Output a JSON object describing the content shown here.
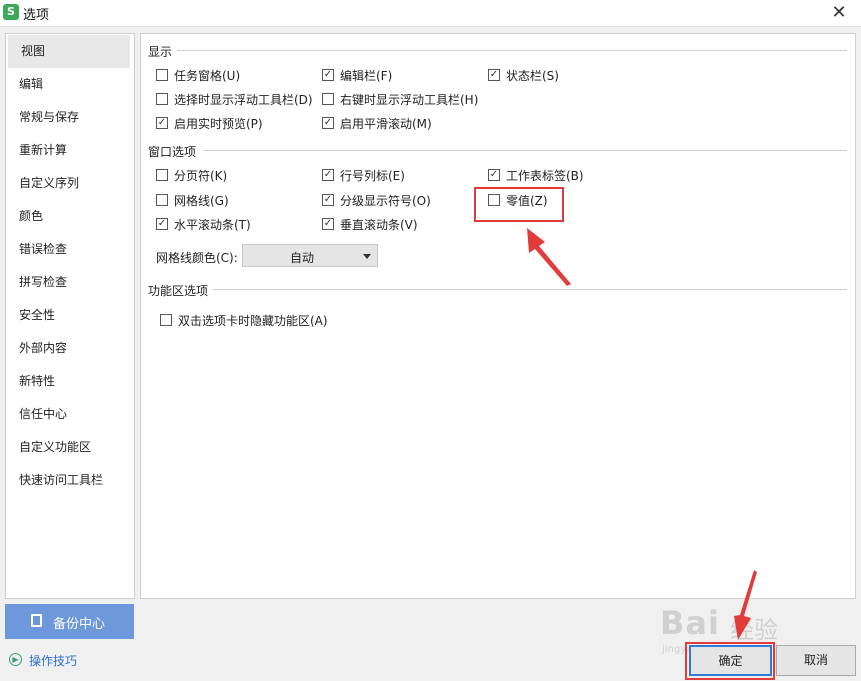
{
  "window": {
    "title": "选项",
    "app_icon_letter": "S",
    "close_symbol": "✕"
  },
  "sidebar": {
    "items": [
      {
        "label": "视图",
        "active": true
      },
      {
        "label": "编辑"
      },
      {
        "label": "常规与保存"
      },
      {
        "label": "重新计算"
      },
      {
        "label": "自定义序列"
      },
      {
        "label": "颜色"
      },
      {
        "label": "错误检查"
      },
      {
        "label": "拼写检查"
      },
      {
        "label": "安全性"
      },
      {
        "label": "外部内容"
      },
      {
        "label": "新特性"
      },
      {
        "label": "信任中心"
      },
      {
        "label": "自定义功能区"
      },
      {
        "label": "快速访问工具栏"
      }
    ]
  },
  "backup_button": {
    "label": "备份中心",
    "icon": "document-icon"
  },
  "tips_link": {
    "label": "操作技巧",
    "icon": "play-circle-icon"
  },
  "sections": {
    "display": {
      "title": "显示",
      "options": [
        {
          "label": "任务窗格(U)",
          "checked": false
        },
        {
          "label": "编辑栏(F)",
          "checked": true
        },
        {
          "label": "状态栏(S)",
          "checked": true
        },
        {
          "label": "选择时显示浮动工具栏(D)",
          "checked": false
        },
        {
          "label": "右键时显示浮动工具栏(H)",
          "checked": false
        },
        {
          "label": "启用实时预览(P)",
          "checked": true
        },
        {
          "label": "启用平滑滚动(M)",
          "checked": true
        }
      ]
    },
    "window_options": {
      "title": "窗口选项",
      "options": [
        {
          "label": "分页符(K)",
          "checked": false
        },
        {
          "label": "行号列标(E)",
          "checked": true
        },
        {
          "label": "工作表标签(B)",
          "checked": true
        },
        {
          "label": "网格线(G)",
          "checked": false
        },
        {
          "label": "分级显示符号(O)",
          "checked": true
        },
        {
          "label": "零值(Z)",
          "checked": false
        },
        {
          "label": "水平滚动条(T)",
          "checked": true
        },
        {
          "label": "垂直滚动条(V)",
          "checked": true
        }
      ],
      "gridline_color": {
        "label": "网格线颜色(C):",
        "value": "自动"
      }
    },
    "ribbon": {
      "title": "功能区选项",
      "options": [
        {
          "label": "双击选项卡时隐藏功能区(A)",
          "checked": false
        }
      ]
    }
  },
  "buttons": {
    "ok": "确定",
    "cancel": "取消"
  },
  "annotation_color": "#e23b3b",
  "watermark": {
    "brand": "Bai",
    "suffix": "经验",
    "url": "jingyan.baidu.com"
  }
}
